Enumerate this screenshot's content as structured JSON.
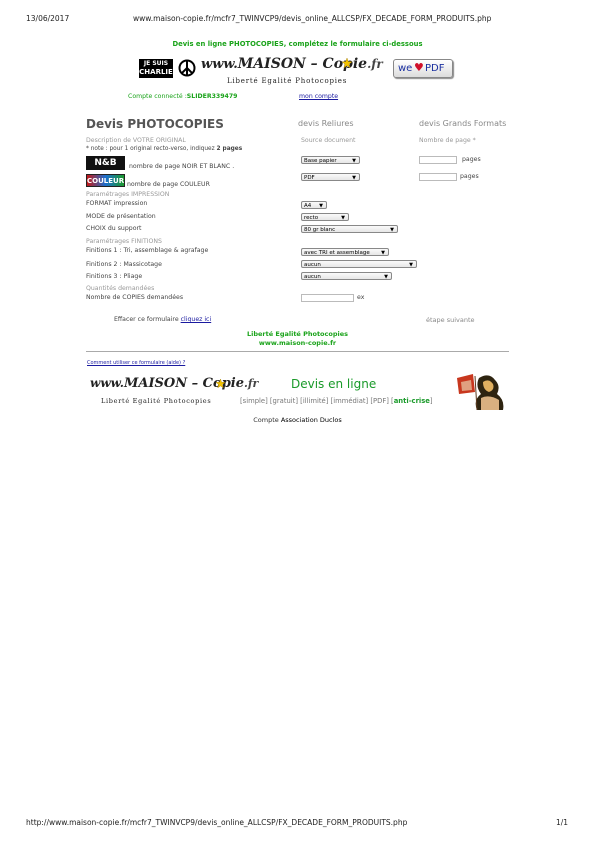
{
  "print_header": {
    "date": "13/06/2017",
    "url": "www.maison-copie.fr/mcfr7_TWINVCP9/devis_online_ALLCSP/FX_DECADE_FORM_PRODUITS.php"
  },
  "intro_text": "Devis en ligne PHOTOCOPIES, complétez le formulaire ci-dessous",
  "banner": {
    "charlie_line1": "JE SUIS",
    "charlie_line2": "CHARLIE",
    "logo_www": "www.",
    "logo_main": "MAISON – Copie",
    "logo_tld": ".fr",
    "logo_tagline": "Liberté Egalité Photocopies",
    "we_text": "we",
    "pdf_text": "PDF"
  },
  "account": {
    "connected_label": "Compte connecté :",
    "connected_user": "SLIDER339479",
    "my_account_link": "mon compte"
  },
  "tabs": {
    "photocopies": "Devis PHOTOCOPIES",
    "reliures": "devis Reliures",
    "grands_formats": "devis Grands Formats"
  },
  "form": {
    "desc_section": "Description de VOTRE ORIGINAL",
    "source_header": "Source document",
    "pages_header": "Nombre de page *",
    "note_prefix": "* note : pour 1 original recto-verso, indiquez ",
    "note_bold": "2 pages",
    "nb_badge": "N&B",
    "nb_label": "nombre de page NOIR ET BLANC .",
    "nb_source": "Base papier",
    "pages_unit": "pages",
    "color_badge": "COULEUR",
    "color_label": "nombre de page COULEUR",
    "color_source": "PDF",
    "impression_section": "Paramétrages IMPRESSION",
    "format_label": "FORMAT impression",
    "format_value": "A4",
    "mode_label": "MODE de présentation",
    "mode_value": "recto",
    "support_label": "CHOIX du support",
    "support_value": "80 gr blanc",
    "finitions_section": "Paramétrages FINITIONS",
    "fin1_label": "Finitions 1 : Tri, assemblage & agrafage",
    "fin1_value": "avec TRI et assemblage",
    "fin2_label": "Finitions 2 : Massicotage",
    "fin2_value": "aucun",
    "fin3_label": "Finitions 3 : Pliage",
    "fin3_value": "aucun",
    "qty_section": "Quantités demandées",
    "copies_label": "Nombre de COPIES demandées",
    "copies_unit": "ex",
    "clear_prefix": "Effacer ce formulaire ",
    "clear_link": "cliquez ici",
    "next_step": "étape suivante"
  },
  "footer_slogan": "Liberté Egalité Photocopies",
  "footer_site": "www.maison-copie.fr",
  "help_link": "Comment utiliser ce formulaire (aide) ?",
  "bottom_banner": {
    "logo_www": "www.",
    "logo_main": "MAISON – Copie",
    "logo_tld": ".fr",
    "logo_tagline": "Liberté Egalité Photocopies",
    "devis_title": "Devis en ligne",
    "tags": "[simple] [gratuit] [illimité] [immédiat] [PDF] [",
    "tags_highlight": "anti-crise",
    "tags_end": "]"
  },
  "account_footer": {
    "prefix": "Compte",
    "name": "Association Duclos"
  },
  "print_footer": {
    "url": "http://www.maison-copie.fr/mcfr7_TWINVCP9/devis_online_ALLCSP/FX_DECADE_FORM_PRODUITS.php",
    "page": "1/1"
  }
}
